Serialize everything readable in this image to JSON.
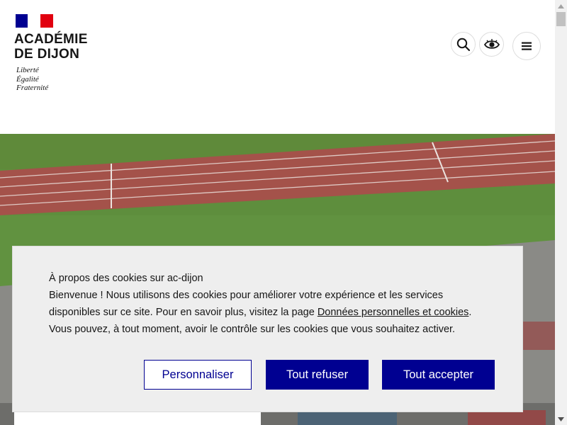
{
  "header": {
    "org_line1": "ACADÉMIE",
    "org_line2": "DE DIJON",
    "motto": [
      "Liberté",
      "Égalité",
      "Fraternité"
    ],
    "flag_colors": [
      "#000091",
      "#ffffff",
      "#e1000f"
    ]
  },
  "toolbar": {
    "search_icon": "search-icon",
    "accessibility_icon": "eye-icon",
    "menu_icon": "hamburger-menu-icon"
  },
  "cookie_banner": {
    "title": "À propos des cookies sur ac-dijon",
    "text_part1": "Bienvenue ! Nous utilisons des cookies pour améliorer votre expérience et les services disponibles sur ce site. Pour en savoir plus, visitez la page ",
    "link_label": "Données personnelles et cookies",
    "text_part2": ". Vous pouvez, à tout moment, avoir le contrôle sur les cookies que vous souhaitez activer.",
    "customize_label": "Personnaliser",
    "refuse_label": "Tout refuser",
    "accept_label": "Tout accepter"
  },
  "colors": {
    "brand_blue": "#000091",
    "banner_bg": "#eeeeee"
  }
}
